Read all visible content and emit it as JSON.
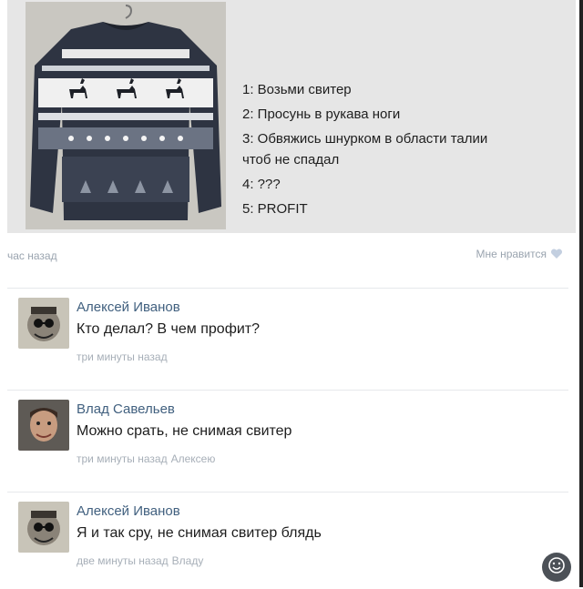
{
  "post": {
    "instructions": [
      "1: Возьми свитер",
      "2: Просунь в рукава ноги",
      "3: Обвяжись шнурком в области талии",
      "чтоб не спадал",
      "4: ???",
      "5: PROFIT"
    ],
    "time": "час назад",
    "like_label": "Мне нравится"
  },
  "comments": [
    {
      "author": "Алексей Иванов",
      "text": "Кто делал? В чем профит?",
      "time": "три минуты назад",
      "reply_to": ""
    },
    {
      "author": "Влад Савельев",
      "text": "Можно срать, не снимая свитер",
      "time": "три минуты назад",
      "reply_to": "Алексею"
    },
    {
      "author": "Алексей Иванов",
      "text": "Я и так сру, не снимая свитер блядь",
      "time": "две минуты назад",
      "reply_to": "Владу"
    }
  ],
  "colors": {
    "author": "#41607f",
    "meta": "#a7afb8",
    "heart": "#c3cfe0"
  },
  "icons": {
    "like": "heart-icon",
    "fab": "emoji-icon"
  }
}
